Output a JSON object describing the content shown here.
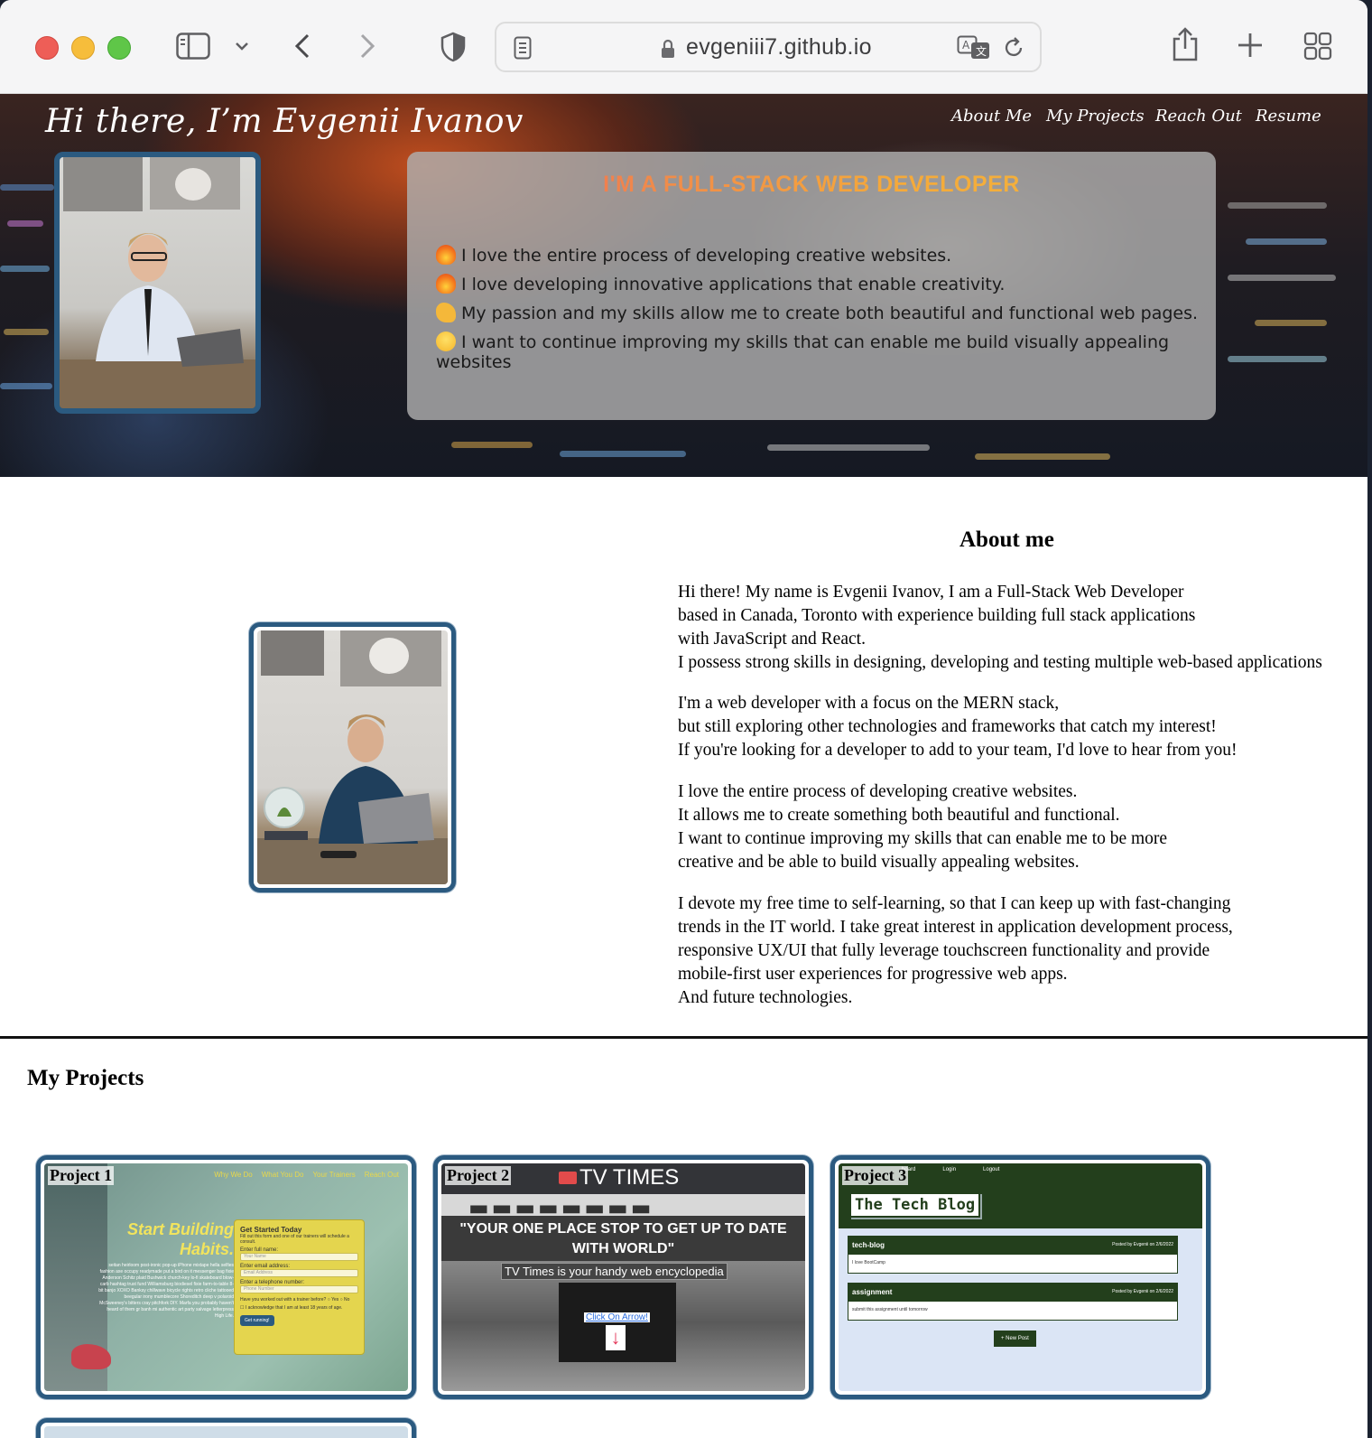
{
  "browser": {
    "url": "evgeniii7.github.io"
  },
  "hero": {
    "title": "Hi there, I’m Evgenii Ivanov",
    "nav": [
      "About Me",
      "My Projects",
      "Reach Out",
      "Resume"
    ],
    "heading": "I'M A FULL-STACK WEB DEVELOPER",
    "lines": [
      {
        "icon": "fire-emoji",
        "text": "I love the entire process of developing creative websites."
      },
      {
        "icon": "fire-emoji",
        "text": "I love developing innovative applications that enable creativity."
      },
      {
        "icon": "flexed-arm-emoji",
        "text": "My passion and my skills allow me to create both beautiful and functional web pages."
      },
      {
        "icon": "monocle-face-emoji",
        "text": "I want to continue improving my skills that can enable me build visually appealing websites"
      }
    ]
  },
  "about": {
    "title": "About me",
    "paragraphs": [
      [
        "Hi there! My name is Evgenii Ivanov, I am a Full-Stack Web Developer",
        "based in Canada, Toronto with experience building full stack applications",
        "with JavaScript and React.",
        "I possess strong skills in designing, developing and testing multiple web-based applications"
      ],
      [
        "I'm a web developer with a focus on the MERN stack,",
        "but still exploring other technologies and frameworks that catch my interest!",
        "If you're looking for a developer to add to your team, I'd love to hear from you!"
      ],
      [
        "I love the entire process of developing creative websites.",
        "It allows me to create something both beautiful and functional.",
        "I want to continue improving my skills that can enable me to be more",
        "creative and be able to build visually appealing websites."
      ],
      [
        "I devote my free time to self-learning, so that I can keep up with fast-changing",
        "trends in the IT world. I take great interest in application development process,",
        "responsive UX/UI that fully leverage touchscreen functionality and provide",
        "mobile-first user experiences for progressive web apps.",
        "And future technologies."
      ]
    ]
  },
  "projects": {
    "title": "My Projects",
    "items": [
      {
        "label": "Project 1",
        "nav": [
          "Why We Do",
          "What You Do",
          "Your Trainers",
          "Reach Out"
        ],
        "headline": [
          "Start Building",
          "Habits."
        ],
        "body": "seitan heirloom post-ironic pop-up iPhone mixtape hella selfies fashion axe occupy readymade put a bird on it messenger bag fixie Anderson Schitz plaid Bushwick church-key lo-fi skateboard blow-carb hashtag trust fund Williamsburg biodiesel fixie farm-to-table 8-bit banjo XOXO Banksy chillwave bicycle rights retro cliche tattooed beegular irony mumblecore Shoreditch deep v polaroid McSweeney's bitters cray pitchfork DIY. Marfa you probably haven't heard of them gr banh mi authentic art party salvage letterpress High Life.",
        "form_title": "Get Started Today",
        "form_sub": "Fill out this form and one of our trainers will schedule a consult.",
        "fields": [
          {
            "label": "Enter full name:",
            "placeholder": "Your Name"
          },
          {
            "label": "Enter email address:",
            "placeholder": "Email Address"
          },
          {
            "label": "Enter a telephone number:",
            "placeholder": "Phone Number"
          }
        ],
        "question": "Have you worked out with a trainer before?",
        "yes": "Yes",
        "no": "No",
        "ack": "I acknowledge that I am at least 18 years of age.",
        "button": "Get running!"
      },
      {
        "label": "Project 2",
        "brand": "TV TIMES",
        "tagline": "\"YOUR ONE PLACE STOP TO GET UP TO DATE WITH WORLD\"",
        "sub": "TV Times is your handy web encyclopedia",
        "link": "Click On Arrow!",
        "arrow": "↓"
      },
      {
        "label": "Project 3",
        "nav": [
          "board",
          "Login",
          "Logout"
        ],
        "brand": "The Tech Blog",
        "posts": [
          {
            "title": "tech-blog",
            "meta": "Posted by Evgenii on 2/6/2022",
            "body": "I love BootCamp"
          },
          {
            "title": "assignment",
            "meta": "Posted by Evgenii on 2/6/2022",
            "body": "submit this assignment until tomorrow"
          }
        ],
        "button": "+ New Post"
      }
    ]
  },
  "colors": {
    "frame": "#2b5a80",
    "blog_green": "#233f1c",
    "form_yellow": "#e4d54e"
  }
}
